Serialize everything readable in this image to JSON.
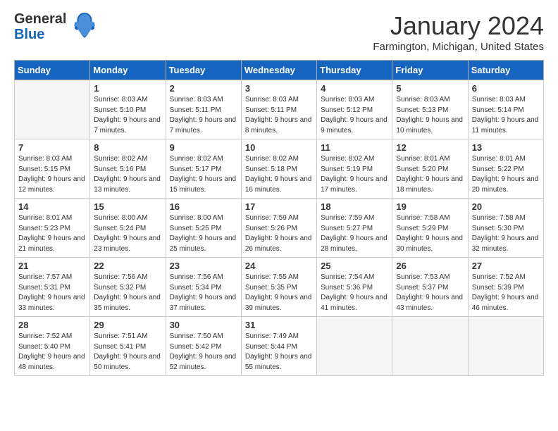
{
  "header": {
    "logo_line1": "General",
    "logo_line2": "Blue",
    "month": "January 2024",
    "location": "Farmington, Michigan, United States"
  },
  "days_of_week": [
    "Sunday",
    "Monday",
    "Tuesday",
    "Wednesday",
    "Thursday",
    "Friday",
    "Saturday"
  ],
  "weeks": [
    [
      {
        "num": "",
        "info": ""
      },
      {
        "num": "1",
        "info": "Sunrise: 8:03 AM\nSunset: 5:10 PM\nDaylight: 9 hours\nand 7 minutes."
      },
      {
        "num": "2",
        "info": "Sunrise: 8:03 AM\nSunset: 5:11 PM\nDaylight: 9 hours\nand 7 minutes."
      },
      {
        "num": "3",
        "info": "Sunrise: 8:03 AM\nSunset: 5:11 PM\nDaylight: 9 hours\nand 8 minutes."
      },
      {
        "num": "4",
        "info": "Sunrise: 8:03 AM\nSunset: 5:12 PM\nDaylight: 9 hours\nand 9 minutes."
      },
      {
        "num": "5",
        "info": "Sunrise: 8:03 AM\nSunset: 5:13 PM\nDaylight: 9 hours\nand 10 minutes."
      },
      {
        "num": "6",
        "info": "Sunrise: 8:03 AM\nSunset: 5:14 PM\nDaylight: 9 hours\nand 11 minutes."
      }
    ],
    [
      {
        "num": "7",
        "info": "Sunrise: 8:03 AM\nSunset: 5:15 PM\nDaylight: 9 hours\nand 12 minutes."
      },
      {
        "num": "8",
        "info": "Sunrise: 8:02 AM\nSunset: 5:16 PM\nDaylight: 9 hours\nand 13 minutes."
      },
      {
        "num": "9",
        "info": "Sunrise: 8:02 AM\nSunset: 5:17 PM\nDaylight: 9 hours\nand 15 minutes."
      },
      {
        "num": "10",
        "info": "Sunrise: 8:02 AM\nSunset: 5:18 PM\nDaylight: 9 hours\nand 16 minutes."
      },
      {
        "num": "11",
        "info": "Sunrise: 8:02 AM\nSunset: 5:19 PM\nDaylight: 9 hours\nand 17 minutes."
      },
      {
        "num": "12",
        "info": "Sunrise: 8:01 AM\nSunset: 5:20 PM\nDaylight: 9 hours\nand 18 minutes."
      },
      {
        "num": "13",
        "info": "Sunrise: 8:01 AM\nSunset: 5:22 PM\nDaylight: 9 hours\nand 20 minutes."
      }
    ],
    [
      {
        "num": "14",
        "info": "Sunrise: 8:01 AM\nSunset: 5:23 PM\nDaylight: 9 hours\nand 21 minutes."
      },
      {
        "num": "15",
        "info": "Sunrise: 8:00 AM\nSunset: 5:24 PM\nDaylight: 9 hours\nand 23 minutes."
      },
      {
        "num": "16",
        "info": "Sunrise: 8:00 AM\nSunset: 5:25 PM\nDaylight: 9 hours\nand 25 minutes."
      },
      {
        "num": "17",
        "info": "Sunrise: 7:59 AM\nSunset: 5:26 PM\nDaylight: 9 hours\nand 26 minutes."
      },
      {
        "num": "18",
        "info": "Sunrise: 7:59 AM\nSunset: 5:27 PM\nDaylight: 9 hours\nand 28 minutes."
      },
      {
        "num": "19",
        "info": "Sunrise: 7:58 AM\nSunset: 5:29 PM\nDaylight: 9 hours\nand 30 minutes."
      },
      {
        "num": "20",
        "info": "Sunrise: 7:58 AM\nSunset: 5:30 PM\nDaylight: 9 hours\nand 32 minutes."
      }
    ],
    [
      {
        "num": "21",
        "info": "Sunrise: 7:57 AM\nSunset: 5:31 PM\nDaylight: 9 hours\nand 33 minutes."
      },
      {
        "num": "22",
        "info": "Sunrise: 7:56 AM\nSunset: 5:32 PM\nDaylight: 9 hours\nand 35 minutes."
      },
      {
        "num": "23",
        "info": "Sunrise: 7:56 AM\nSunset: 5:34 PM\nDaylight: 9 hours\nand 37 minutes."
      },
      {
        "num": "24",
        "info": "Sunrise: 7:55 AM\nSunset: 5:35 PM\nDaylight: 9 hours\nand 39 minutes."
      },
      {
        "num": "25",
        "info": "Sunrise: 7:54 AM\nSunset: 5:36 PM\nDaylight: 9 hours\nand 41 minutes."
      },
      {
        "num": "26",
        "info": "Sunrise: 7:53 AM\nSunset: 5:37 PM\nDaylight: 9 hours\nand 43 minutes."
      },
      {
        "num": "27",
        "info": "Sunrise: 7:52 AM\nSunset: 5:39 PM\nDaylight: 9 hours\nand 46 minutes."
      }
    ],
    [
      {
        "num": "28",
        "info": "Sunrise: 7:52 AM\nSunset: 5:40 PM\nDaylight: 9 hours\nand 48 minutes."
      },
      {
        "num": "29",
        "info": "Sunrise: 7:51 AM\nSunset: 5:41 PM\nDaylight: 9 hours\nand 50 minutes."
      },
      {
        "num": "30",
        "info": "Sunrise: 7:50 AM\nSunset: 5:42 PM\nDaylight: 9 hours\nand 52 minutes."
      },
      {
        "num": "31",
        "info": "Sunrise: 7:49 AM\nSunset: 5:44 PM\nDaylight: 9 hours\nand 55 minutes."
      },
      {
        "num": "",
        "info": ""
      },
      {
        "num": "",
        "info": ""
      },
      {
        "num": "",
        "info": ""
      }
    ]
  ]
}
